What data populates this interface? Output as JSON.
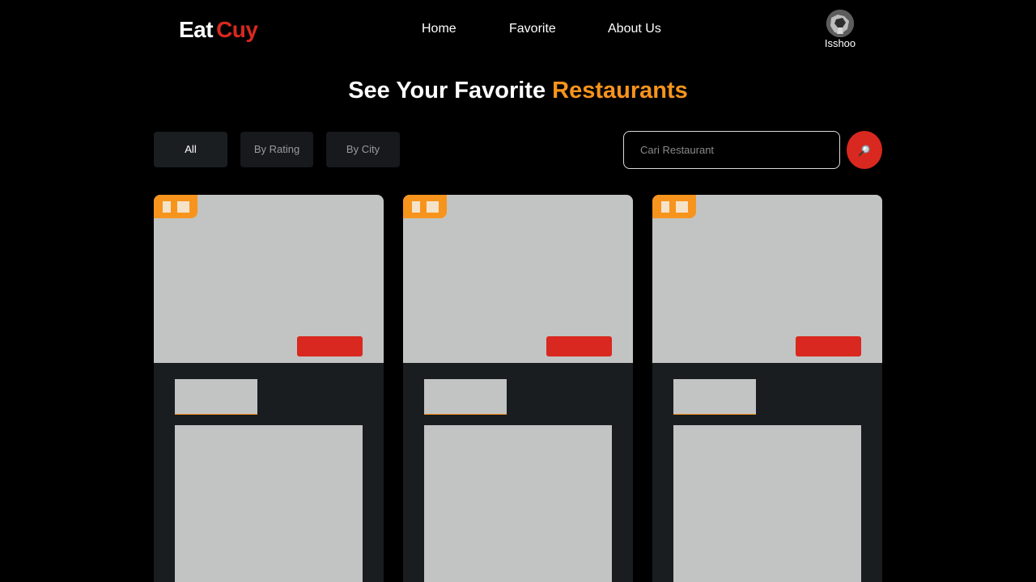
{
  "header": {
    "logo_part1": "Eat",
    "logo_part2": "Cuy",
    "nav": [
      {
        "label": "Home"
      },
      {
        "label": "Favorite"
      },
      {
        "label": "About Us"
      }
    ],
    "user": {
      "name": "Isshoo"
    }
  },
  "page": {
    "title_main": "See Your Favorite",
    "title_accent": "Restaurants"
  },
  "filters": [
    {
      "label": "All",
      "active": true
    },
    {
      "label": "By Rating",
      "active": false
    },
    {
      "label": "By City",
      "active": false
    }
  ],
  "search": {
    "placeholder": "Cari Restaurant",
    "value": "",
    "icon": "search-icon"
  },
  "cards": [
    {
      "state": "loading-skeleton"
    },
    {
      "state": "loading-skeleton"
    },
    {
      "state": "loading-skeleton"
    }
  ],
  "colors": {
    "background": "#000000",
    "brand_red": "#d9281f",
    "accent_orange": "#f7941d",
    "card_bg": "#1a1d20",
    "skeleton": "#c2c4c3"
  }
}
